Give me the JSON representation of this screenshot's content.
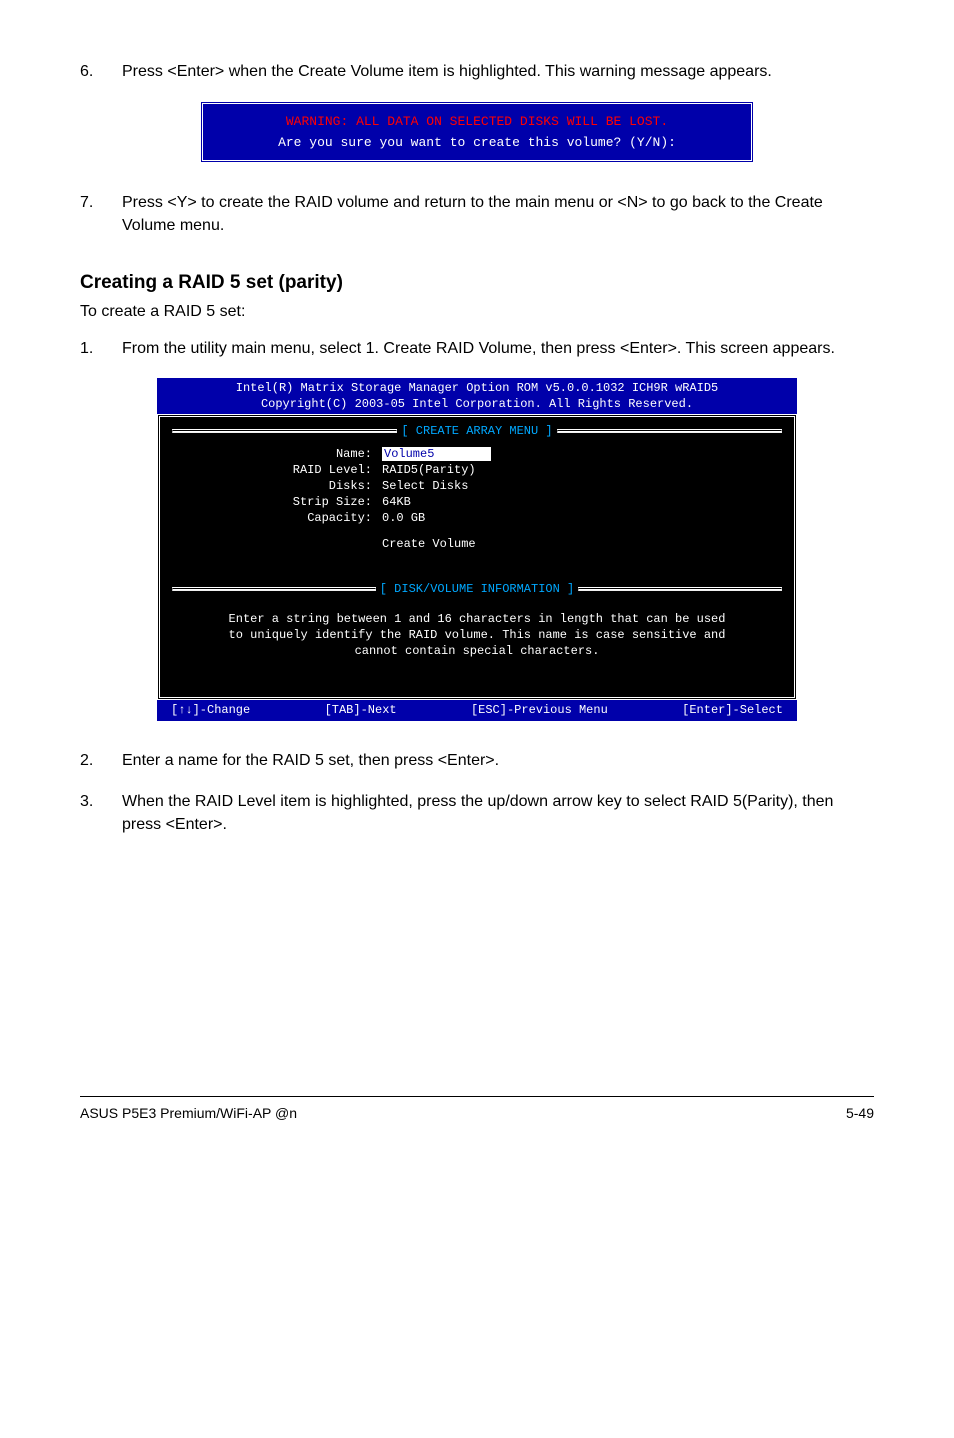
{
  "step6": {
    "num": "6.",
    "text": "Press <Enter> when the Create Volume item is highlighted. This warning message appears."
  },
  "warn_box": {
    "warning": "WARNING: ALL DATA ON SELECTED DISKS WILL BE LOST.",
    "prompt": "Are you sure you want to create this volume? (Y/N):"
  },
  "step7": {
    "num": "7.",
    "text": "Press <Y> to create the RAID volume and return to the main menu or <N> to go back to the Create Volume menu."
  },
  "heading": "Creating a RAID 5 set (parity)",
  "subtext": "To create a RAID 5 set:",
  "step1": {
    "num": "1.",
    "text": "From the utility main menu, select 1. Create RAID Volume, then press <Enter>. This screen appears."
  },
  "bios2": {
    "hdr1": "Intel(R) Matrix Storage Manager Option ROM v5.0.0.1032 ICH9R wRAID5",
    "hdr2": "Copyright(C) 2003-05 Intel Corporation. All Rights Reserved.",
    "sect_create": "[ CREATE ARRAY MENU ]",
    "labels": {
      "name": "Name:",
      "raid": "RAID Level:",
      "disks": "Disks:",
      "strip": "Strip Size:",
      "cap": "Capacity:"
    },
    "vals": {
      "name": "Volume5",
      "raid": "RAID5(Parity)",
      "disks": "Select Disks",
      "strip": "64KB",
      "cap": "0.0  GB"
    },
    "create_vol": "Create Volume",
    "sect_info": "[ DISK/VOLUME INFORMATION ]",
    "help1": "Enter a string between 1 and 16 characters in length that can be used",
    "help2": "to uniquely identify the RAID volume. This name is case sensitive and",
    "help3": "cannot contain special characters.",
    "foot": {
      "change": "[↑↓]-Change",
      "next": "[TAB]-Next",
      "prev": "[ESC]-Previous Menu",
      "select": "[Enter]-Select"
    }
  },
  "step2": {
    "num": "2.",
    "text": "Enter a name for the RAID 5 set, then press <Enter>."
  },
  "step3": {
    "num": "3.",
    "text": "When the RAID Level item is highlighted, press the up/down arrow key to select RAID 5(Parity), then press <Enter>."
  },
  "footer": {
    "left": "ASUS P5E3 Premium/WiFi-AP @n",
    "right": "5-49"
  }
}
